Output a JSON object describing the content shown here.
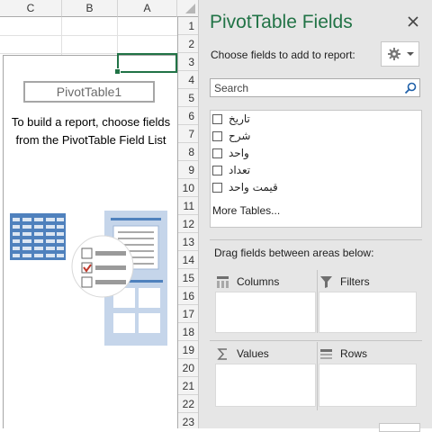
{
  "sheet": {
    "columns": [
      "C",
      "B",
      "A"
    ],
    "rows": [
      "1",
      "2",
      "3",
      "4",
      "5",
      "6",
      "7",
      "8",
      "9",
      "10",
      "11",
      "12",
      "13",
      "14",
      "15",
      "16",
      "17",
      "18",
      "19",
      "20",
      "21",
      "22",
      "23"
    ],
    "pivot": {
      "name": "PivotTable1",
      "hint": "To build a report, choose fields from the PivotTable Field List"
    }
  },
  "pane": {
    "title": "PivotTable Fields",
    "close_icon": "close-icon",
    "choose_label": "Choose fields to add to report:",
    "search_placeholder": "Search",
    "fields": [
      {
        "label": "تاریخ",
        "checked": false
      },
      {
        "label": "شرح",
        "checked": false
      },
      {
        "label": "واحد",
        "checked": false
      },
      {
        "label": "تعداد",
        "checked": false
      },
      {
        "label": "قیمت واحد",
        "checked": false
      }
    ],
    "more_tables": "More Tables...",
    "drag_label": "Drag fields between areas below:",
    "areas": {
      "columns": "Columns",
      "filters": "Filters",
      "values": "Values",
      "rows": "Rows"
    }
  },
  "colors": {
    "accent": "#217346",
    "pane_bg": "#e6e6e6",
    "illustration_blue": "#4f81bd"
  }
}
